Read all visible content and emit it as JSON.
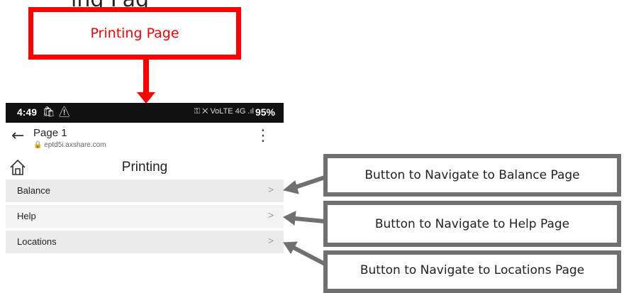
{
  "header_fragment": "ing Pag",
  "callout": {
    "label": "Printing Page",
    "color": "#ff0000"
  },
  "status_bar": {
    "time": "4:49",
    "icons": "⚿ ✕ VoLTE 4G .ıl",
    "battery": "95%"
  },
  "browser": {
    "title": "Page 1",
    "url": "eptd5i.axshare.com"
  },
  "app": {
    "title": "Printing",
    "items": [
      {
        "label": "Balance",
        "chevron": ">"
      },
      {
        "label": "Help",
        "chevron": ">"
      },
      {
        "label": "Locations",
        "chevron": ">"
      }
    ]
  },
  "annotations": [
    {
      "text": "Button to Navigate to Balance Page"
    },
    {
      "text": "Button to Navigate to Help Page"
    },
    {
      "text": "Button to Navigate to Locations Page"
    }
  ]
}
